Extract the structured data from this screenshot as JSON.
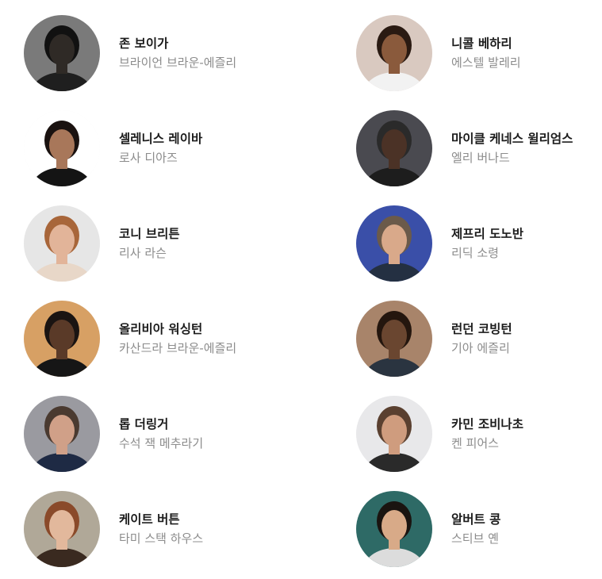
{
  "cast": [
    {
      "actor": "존 보이가",
      "role": "브라이언 브라운-에즐리",
      "avatar_icon": "actor-portrait-icon",
      "bg": "#7a7a7a",
      "skin": "#2f2a26",
      "hair": "#111111",
      "shirt": "#1f1f1f"
    },
    {
      "actor": "니콜 베하리",
      "role": "에스텔 발레리",
      "avatar_icon": "actor-portrait-icon",
      "bg": "#d9c9c0",
      "skin": "#8a5a3c",
      "hair": "#2a1a12",
      "shirt": "#f2f2f2"
    },
    {
      "actor": "셀레니스 레이바",
      "role": "로사 디아즈",
      "avatar_icon": "actor-portrait-icon",
      "bg": "#ffffff",
      "skin": "#a8775a",
      "hair": "#1a1210",
      "shirt": "#141414"
    },
    {
      "actor": "마이클 케네스 윌리엄스",
      "role": "엘리 버나드",
      "avatar_icon": "actor-portrait-icon",
      "bg": "#4a4a50",
      "skin": "#4b3226",
      "hair": "#2a2a2a",
      "shirt": "#1d1d1d"
    },
    {
      "actor": "코니 브리튼",
      "role": "리사 라슨",
      "avatar_icon": "actor-portrait-icon",
      "bg": "#e6e6e6",
      "skin": "#e2b499",
      "hair": "#a8663a",
      "shirt": "#e8d7c8"
    },
    {
      "actor": "제프리 도노반",
      "role": "리딕 소령",
      "avatar_icon": "actor-portrait-icon",
      "bg": "#3a4fa8",
      "skin": "#d9a98a",
      "hair": "#6b5a4a",
      "shirt": "#243042"
    },
    {
      "actor": "올리비아 워싱턴",
      "role": "카산드라 브라운-에즐리",
      "avatar_icon": "actor-portrait-icon",
      "bg": "#d7a064",
      "skin": "#5a3a28",
      "hair": "#1a1412",
      "shirt": "#161616"
    },
    {
      "actor": "런던 코빙턴",
      "role": "기아 에즐리",
      "avatar_icon": "actor-portrait-icon",
      "bg": "#a8846a",
      "skin": "#6a4630",
      "hair": "#24160e",
      "shirt": "#2a3440"
    },
    {
      "actor": "롭 더링거",
      "role": "수석 잭 메추라기",
      "avatar_icon": "actor-portrait-icon",
      "bg": "#9a9aa0",
      "skin": "#d0a088",
      "hair": "#4a3a30",
      "shirt": "#1e2a44"
    },
    {
      "actor": "카민 조비나초",
      "role": "켄 피어스",
      "avatar_icon": "actor-portrait-icon",
      "bg": "#e8e8ea",
      "skin": "#cf9c7e",
      "hair": "#5a4030",
      "shirt": "#2a2a2a"
    },
    {
      "actor": "케이트 버튼",
      "role": "타미 스택 하우스",
      "avatar_icon": "actor-portrait-icon",
      "bg": "#b0a898",
      "skin": "#e2b89c",
      "hair": "#8a4a2a",
      "shirt": "#3a2a20"
    },
    {
      "actor": "알버트 콩",
      "role": "스티브 옌",
      "avatar_icon": "actor-portrait-icon",
      "bg": "#2e6a66",
      "skin": "#d8aa88",
      "hair": "#1a1410",
      "shirt": "#dcdcdc"
    }
  ],
  "colors": {
    "name_text": "#1c1c1c",
    "role_text": "#8c8c8c",
    "background": "#ffffff"
  }
}
